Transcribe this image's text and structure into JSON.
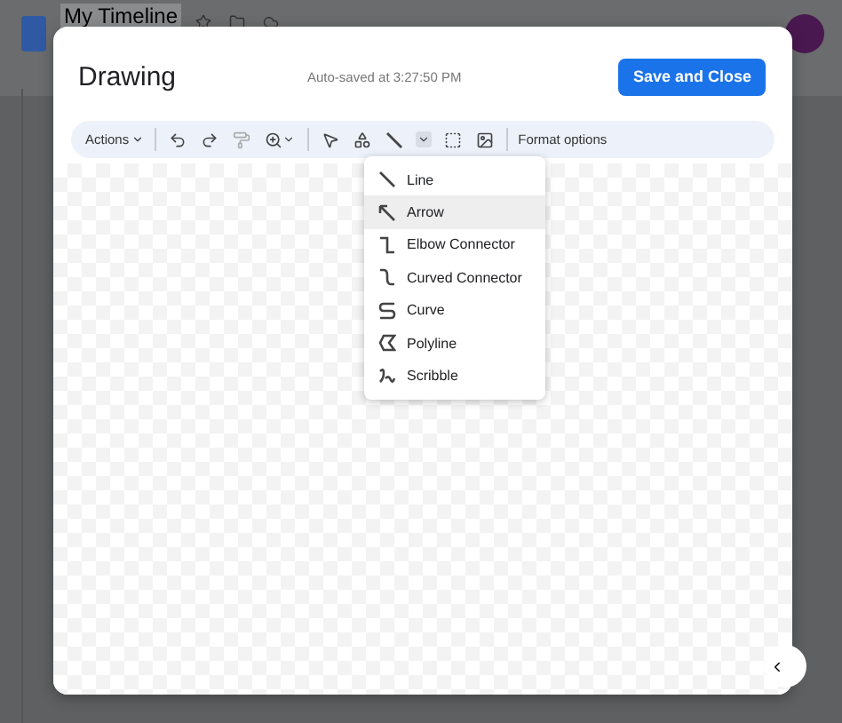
{
  "document": {
    "title": "My Timeline"
  },
  "dialog": {
    "title": "Drawing",
    "autosave": "Auto-saved at 3:27:50 PM",
    "save_button": "Save and Close"
  },
  "toolbar": {
    "actions": "Actions",
    "format_options": "Format options"
  },
  "line_menu": [
    {
      "kind": "line",
      "label": "Line",
      "selected": false
    },
    {
      "kind": "arrow",
      "label": "Arrow",
      "selected": true
    },
    {
      "kind": "elbow",
      "label": "Elbow Connector",
      "selected": false
    },
    {
      "kind": "curved",
      "label": "Curved Connector",
      "selected": false
    },
    {
      "kind": "curve",
      "label": "Curve",
      "selected": false
    },
    {
      "kind": "polyline",
      "label": "Polyline",
      "selected": false
    },
    {
      "kind": "scribble",
      "label": "Scribble",
      "selected": false
    }
  ]
}
